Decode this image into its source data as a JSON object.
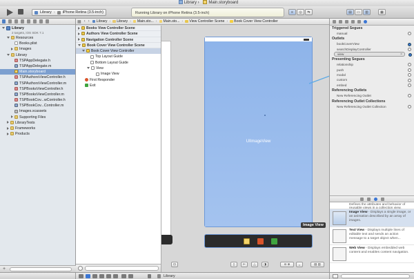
{
  "window": {
    "title": "Library",
    "file": "Main.storyboard"
  },
  "toolbar": {
    "scheme_target": "Library",
    "scheme_device": "iPhone Retina (3.5-inch)",
    "status": "Running Library on iPhone Retina (3.5-inch)"
  },
  "navigator": {
    "project": {
      "name": "Library",
      "subtitle": "2 targets, iOS SDK 7.1"
    },
    "items": [
      {
        "label": "Resources"
      },
      {
        "label": "Books.plist"
      },
      {
        "label": "Images"
      },
      {
        "label": "Library"
      },
      {
        "label": "TSPAppDelegate.h"
      },
      {
        "label": "TSPAppDelegate.m"
      },
      {
        "label": "Main.storyboard"
      },
      {
        "label": "TSPAuthorsViewController.h"
      },
      {
        "label": "TSPAuthorsViewController.m"
      },
      {
        "label": "TSPBooksViewController.h"
      },
      {
        "label": "TSPBooksViewController.m"
      },
      {
        "label": "TSPBookCov...wController.h"
      },
      {
        "label": "TSPBookCov...Controller.m"
      },
      {
        "label": "Images.xcassets"
      },
      {
        "label": "Supporting Files"
      },
      {
        "label": "LibraryTests"
      },
      {
        "label": "Frameworks"
      },
      {
        "label": "Products"
      }
    ]
  },
  "jumpbar": {
    "items": [
      "Library",
      "Library",
      "Main.sto...",
      "Main.sto...",
      "View Controller Scene",
      "Book Cover View Controller"
    ]
  },
  "outline": {
    "scenes": [
      {
        "label": "Books View Controller Scene"
      },
      {
        "label": "Authors View Controller Scene"
      },
      {
        "label": "Navigation Controller Scene"
      },
      {
        "label": "Book Cover View Controller Scene"
      }
    ],
    "items": [
      {
        "label": "Book Cover View Controller"
      },
      {
        "label": "Top Layout Guide"
      },
      {
        "label": "Bottom Layout Guide"
      },
      {
        "label": "View"
      },
      {
        "label": "Image View"
      },
      {
        "label": "First Responder"
      },
      {
        "label": "Exit"
      }
    ]
  },
  "canvas": {
    "image_view_label": "UIImageView",
    "tooltip": "Image View"
  },
  "inspector": {
    "triggered_segues": {
      "title": "Triggered Segues",
      "items": [
        "manual"
      ]
    },
    "outlets": {
      "title": "Outlets",
      "items": [
        "bookCoverView",
        "searchDisplayController",
        "view"
      ]
    },
    "presenting_segues": {
      "title": "Presenting Segues",
      "items": [
        "relationship",
        "push",
        "modal",
        "custom",
        "embed"
      ]
    },
    "referencing_outlets": {
      "title": "Referencing Outlets",
      "items": [
        "New Referencing Outlet"
      ]
    },
    "referencing_outlet_collections": {
      "title": "Referencing Outlet Collections",
      "items": [
        "New Referencing Outlet Collection"
      ]
    }
  },
  "library": {
    "cut_text": "Defines the attributes and behavior of reusable views in a collection view.",
    "items": [
      {
        "name": "Image View",
        "desc": " - Displays a single image, or an animation described by an array of images."
      },
      {
        "name": "Text View",
        "desc": " - Displays multiple lines of editable text and sends an action message to a target object when..."
      },
      {
        "name": "Web View",
        "desc": " - Displays embedded web content and enables content navigation."
      }
    ]
  },
  "debugbar": {
    "label": "Library"
  },
  "colors": {
    "accent": "#3b76d4",
    "selection": "#7c9fcf",
    "image_view": "#95b9ec",
    "connection_line": "#5aa9e6"
  }
}
